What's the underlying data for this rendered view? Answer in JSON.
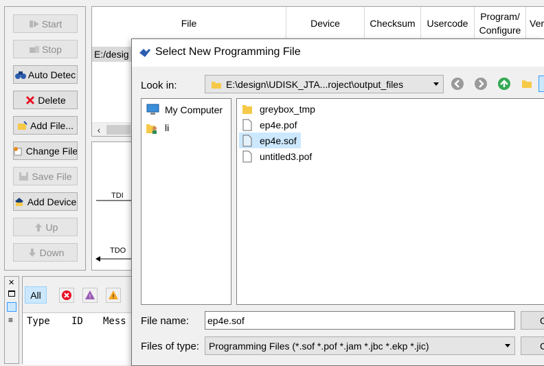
{
  "toolbar": {
    "start": "Start",
    "stop": "Stop",
    "auto_detect": "Auto Detec",
    "delete": "Delete",
    "add_file": "Add File...",
    "change_file": "Change File",
    "save_file": "Save File",
    "add_device": "Add Device",
    "up": "Up",
    "down": "Down"
  },
  "table": {
    "columns": [
      "File",
      "Device",
      "Checksum",
      "Usercode",
      "Program/\nConfigure",
      "Ver"
    ],
    "row_file": "E:/desig"
  },
  "chain": {
    "tdi": "TDI",
    "tdo": "TDO"
  },
  "messages": {
    "filter_all": "All",
    "columns": [
      "Type",
      "ID",
      "Mess"
    ]
  },
  "dialog": {
    "title": "Select New Programming File",
    "look_in_label": "Look in:",
    "look_in_value": "E:\\design\\UDISK_JTA...roject\\output_files",
    "places": [
      "My Computer",
      "li"
    ],
    "files": [
      {
        "name": "greybox_tmp",
        "type": "folder"
      },
      {
        "name": "ep4e.pof",
        "type": "file"
      },
      {
        "name": "ep4e.sof",
        "type": "file",
        "selected": true
      },
      {
        "name": "untitled3.pof",
        "type": "file"
      }
    ],
    "file_name_label": "File name:",
    "file_name_value": "ep4e.sof",
    "files_of_type_label": "Files of type:",
    "files_of_type_value": "Programming Files (*.sof *.pof *.jam *.jbc *.ekp *.jic)",
    "open_label": "O",
    "cancel_label": "Ca"
  },
  "colors": {
    "selection": "#cce8ff",
    "delete_x": "#e81123",
    "folder": "#f7c948",
    "nav_green": "#34a853"
  }
}
